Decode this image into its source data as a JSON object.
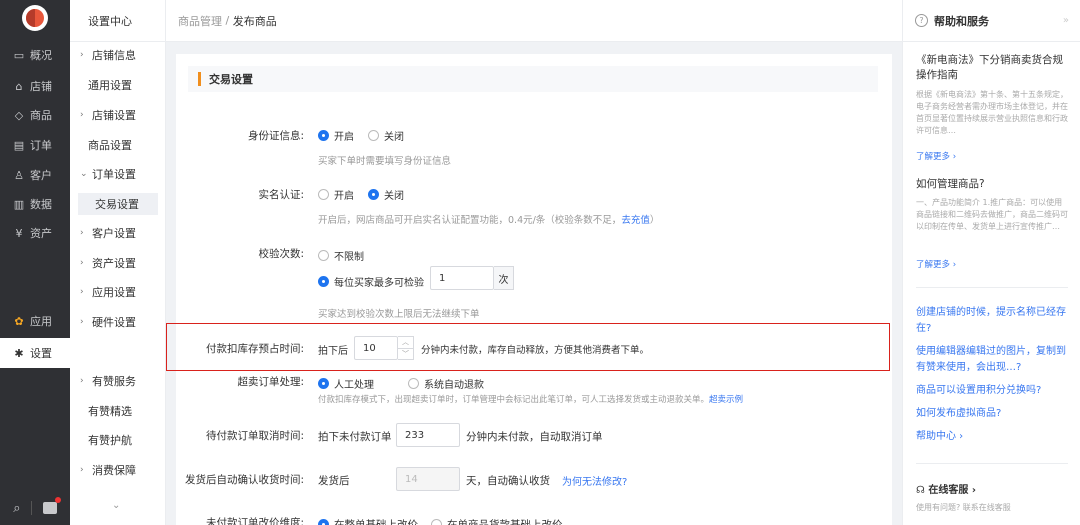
{
  "rail": {
    "items": [
      {
        "icon": "monitor-icon",
        "glyph": "▭",
        "label": "概况"
      },
      {
        "icon": "store-icon",
        "glyph": "⌂",
        "label": "店铺"
      },
      {
        "icon": "tag-icon",
        "glyph": "◇",
        "label": "商品"
      },
      {
        "icon": "order-icon",
        "glyph": "▤",
        "label": "订单"
      },
      {
        "icon": "user-icon",
        "glyph": "♙",
        "label": "客户"
      },
      {
        "icon": "chart-icon",
        "glyph": "▥",
        "label": "数据"
      },
      {
        "icon": "asset-icon",
        "glyph": "¥",
        "label": "资产"
      },
      {
        "icon": "apps-icon",
        "glyph": "✿",
        "label": "应用"
      },
      {
        "icon": "gear-icon",
        "glyph": "✱",
        "label": "设置"
      }
    ]
  },
  "submenu": {
    "title": "设置中心",
    "items": [
      {
        "label": "店铺信息",
        "type": "group",
        "arrow": "›"
      },
      {
        "label": "通用设置",
        "type": "child"
      },
      {
        "label": "店铺设置",
        "type": "group",
        "arrow": "›"
      },
      {
        "label": "商品设置",
        "type": "child"
      },
      {
        "label": "订单设置",
        "type": "group",
        "arrow": "⌄"
      },
      {
        "label": "交易设置",
        "type": "child",
        "active": true
      },
      {
        "label": "客户设置",
        "type": "group",
        "arrow": "›"
      },
      {
        "label": "资产设置",
        "type": "group",
        "arrow": "›"
      },
      {
        "label": "应用设置",
        "type": "group",
        "arrow": "›"
      },
      {
        "label": "硬件设置",
        "type": "group",
        "arrow": "›"
      },
      {
        "label": "有赞服务",
        "type": "group",
        "arrow": "›"
      },
      {
        "label": "有赞精选",
        "type": "child"
      },
      {
        "label": "有赞护航",
        "type": "child"
      },
      {
        "label": "消费保障",
        "type": "group",
        "arrow": "›"
      }
    ]
  },
  "breadcrumb": {
    "parent": "商品管理",
    "sep": " / ",
    "current": "发布商品"
  },
  "section": {
    "title": "交易设置"
  },
  "form": {
    "id_info": {
      "label": "身份证信息:",
      "opt_on": "开启",
      "opt_off": "关闭",
      "hint": "买家下单时需要填写身份证信息"
    },
    "realname": {
      "label": "实名认证:",
      "opt_on": "开启",
      "opt_off": "关闭",
      "hint": "开启后，网店商品可开启实名认证配置功能，0.4元/条（校验条数不足，",
      "hint_link": "去充值",
      "hint_tail": "）"
    },
    "verify_count": {
      "label": "校验次数:",
      "opt_unlimited": "不限制",
      "opt_limit": "每位买家最多可检验",
      "value": "1",
      "unit": "次",
      "hint": "买家达到校验次数上限后无法继续下单"
    },
    "stock_hold": {
      "label": "付款扣库存预占时间:",
      "prefix": "拍下后",
      "value": "10",
      "suffix": "分钟内未付款，库存自动释放，方便其他消费者下单。"
    },
    "oversell": {
      "label": "超卖订单处理:",
      "opt_manual": "人工处理",
      "opt_auto": "系统自动退款",
      "hint": "付款扣库存模式下，出现超卖订单时，订单管理中会标记出此笔订单，可人工选择发货或主动退款关单。",
      "hint_link": "超卖示例"
    },
    "cancel": {
      "label": "待付款订单取消时间:",
      "prefix": "拍下未付款订单",
      "value": "233",
      "suffix": "分钟内未付款，自动取消订单"
    },
    "auto_confirm": {
      "label": "发货后自动确认收货时间:",
      "prefix": "发货后",
      "value": "14",
      "suffix": "天，自动确认收货",
      "link": "为何无法修改?"
    },
    "price_change": {
      "label": "未付款订单改价维度:",
      "opt_whole": "在整单基础上改价",
      "opt_item": "在单商品货款基础上改价"
    }
  },
  "help": {
    "title": "帮助和服务",
    "collapse": "»",
    "articles": [
      {
        "title": "《新电商法》下分销商卖货合规操作指南",
        "desc": "根据《新电商法》第十条、第十五条规定，电子商务经营者需办理市场主体登记，并在首页显著位置持续展示营业执照信息和行政许可信息…",
        "more": "了解更多 ›"
      },
      {
        "title": "如何管理商品?",
        "desc": "一、产品功能简介 1.推广商品：可以使用商品链接和二维码去做推广，商品二维码可以印制在传单、发货单上进行宣传推广…",
        "more": "了解更多 ›"
      }
    ],
    "links": [
      "创建店铺的时候，提示名称已经存在?",
      "使用编辑器编辑过的图片，复制到有赞来使用，会出现…?",
      "商品可以设置用积分兑换吗?",
      "如何发布虚拟商品?",
      "帮助中心 ›"
    ],
    "footer": {
      "title": "在线客服 ›",
      "sub": "使用有问题? 联系在线客服"
    }
  },
  "colors": {
    "accent": "#1e74ef",
    "brand_orange": "#f08e1d",
    "highlight": "#d9221c",
    "link": "#3877f0"
  }
}
